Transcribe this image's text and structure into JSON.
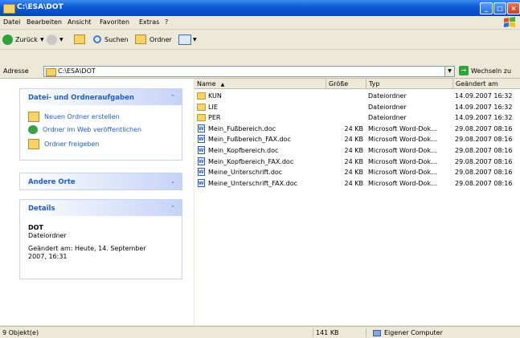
{
  "window": {
    "title": "C:\\ESA\\DOT",
    "min_label": "_",
    "max_label": "□",
    "close_label": "×"
  },
  "menu": {
    "datei": "Datei",
    "bearbeiten": "Bearbeiten",
    "ansicht": "Ansicht",
    "favoriten": "Favoriten",
    "extras": "Extras",
    "help": "?"
  },
  "toolbar": {
    "back_label": "Zurück",
    "search_label": "Suchen",
    "folders_label": "Ordner"
  },
  "address": {
    "label": "Adresse",
    "value": "C:\\ESA\\DOT",
    "go_label": "Wechseln zu"
  },
  "tasks_panel": {
    "title": "Datei- und Ordneraufgaben",
    "items": [
      "Neuen Ordner erstellen",
      "Ordner im Web veröffentlichen",
      "Ordner freigeben"
    ]
  },
  "other_places": {
    "title": "Andere Orte"
  },
  "details": {
    "title": "Details",
    "name": "DOT",
    "type": "Dateiordner",
    "modified_line1": "Geändert am: Heute, 14. September",
    "modified_line2": "2007, 16:31"
  },
  "file_list": {
    "columns": {
      "name": "Name",
      "size": "Größe",
      "type": "Typ",
      "modified": "Geändert am"
    },
    "rows": [
      {
        "name": "KUN",
        "size": "",
        "type": "Dateiordner",
        "modified": "14.09.2007 16:32",
        "kind": "folder"
      },
      {
        "name": "LIE",
        "size": "",
        "type": "Dateiordner",
        "modified": "14.09.2007 16:32",
        "kind": "folder"
      },
      {
        "name": "PER",
        "size": "",
        "type": "Dateiordner",
        "modified": "14.09.2007 16:32",
        "kind": "folder"
      },
      {
        "name": "Mein_Fußbereich.doc",
        "size": "24 KB",
        "type": "Microsoft Word-Dok...",
        "modified": "29.08.2007 08:16",
        "kind": "doc"
      },
      {
        "name": "Mein_Fußbereich_FAX.doc",
        "size": "24 KB",
        "type": "Microsoft Word-Dok...",
        "modified": "29.08.2007 08:16",
        "kind": "doc"
      },
      {
        "name": "Mein_Kopfbereich.doc",
        "size": "24 KB",
        "type": "Microsoft Word-Dok...",
        "modified": "29.08.2007 08:16",
        "kind": "doc"
      },
      {
        "name": "Mein_Kopfbereich_FAX.doc",
        "size": "24 KB",
        "type": "Microsoft Word-Dok...",
        "modified": "29.08.2007 08:16",
        "kind": "doc"
      },
      {
        "name": "Meine_Unterschrift.doc",
        "size": "24 KB",
        "type": "Microsoft Word-Dok...",
        "modified": "29.08.2007 08:16",
        "kind": "doc"
      },
      {
        "name": "Meine_Unterschrift_FAX.doc",
        "size": "24 KB",
        "type": "Microsoft Word-Dok...",
        "modified": "29.08.2007 08:16",
        "kind": "doc"
      }
    ]
  },
  "status": {
    "count": "9 Objekt(e)",
    "size": "141 KB",
    "location": "Eigener Computer"
  },
  "colors": {
    "titlebar": "#0a5ad6",
    "task_link": "#215dc6",
    "window_bg": "#ece9d8"
  }
}
